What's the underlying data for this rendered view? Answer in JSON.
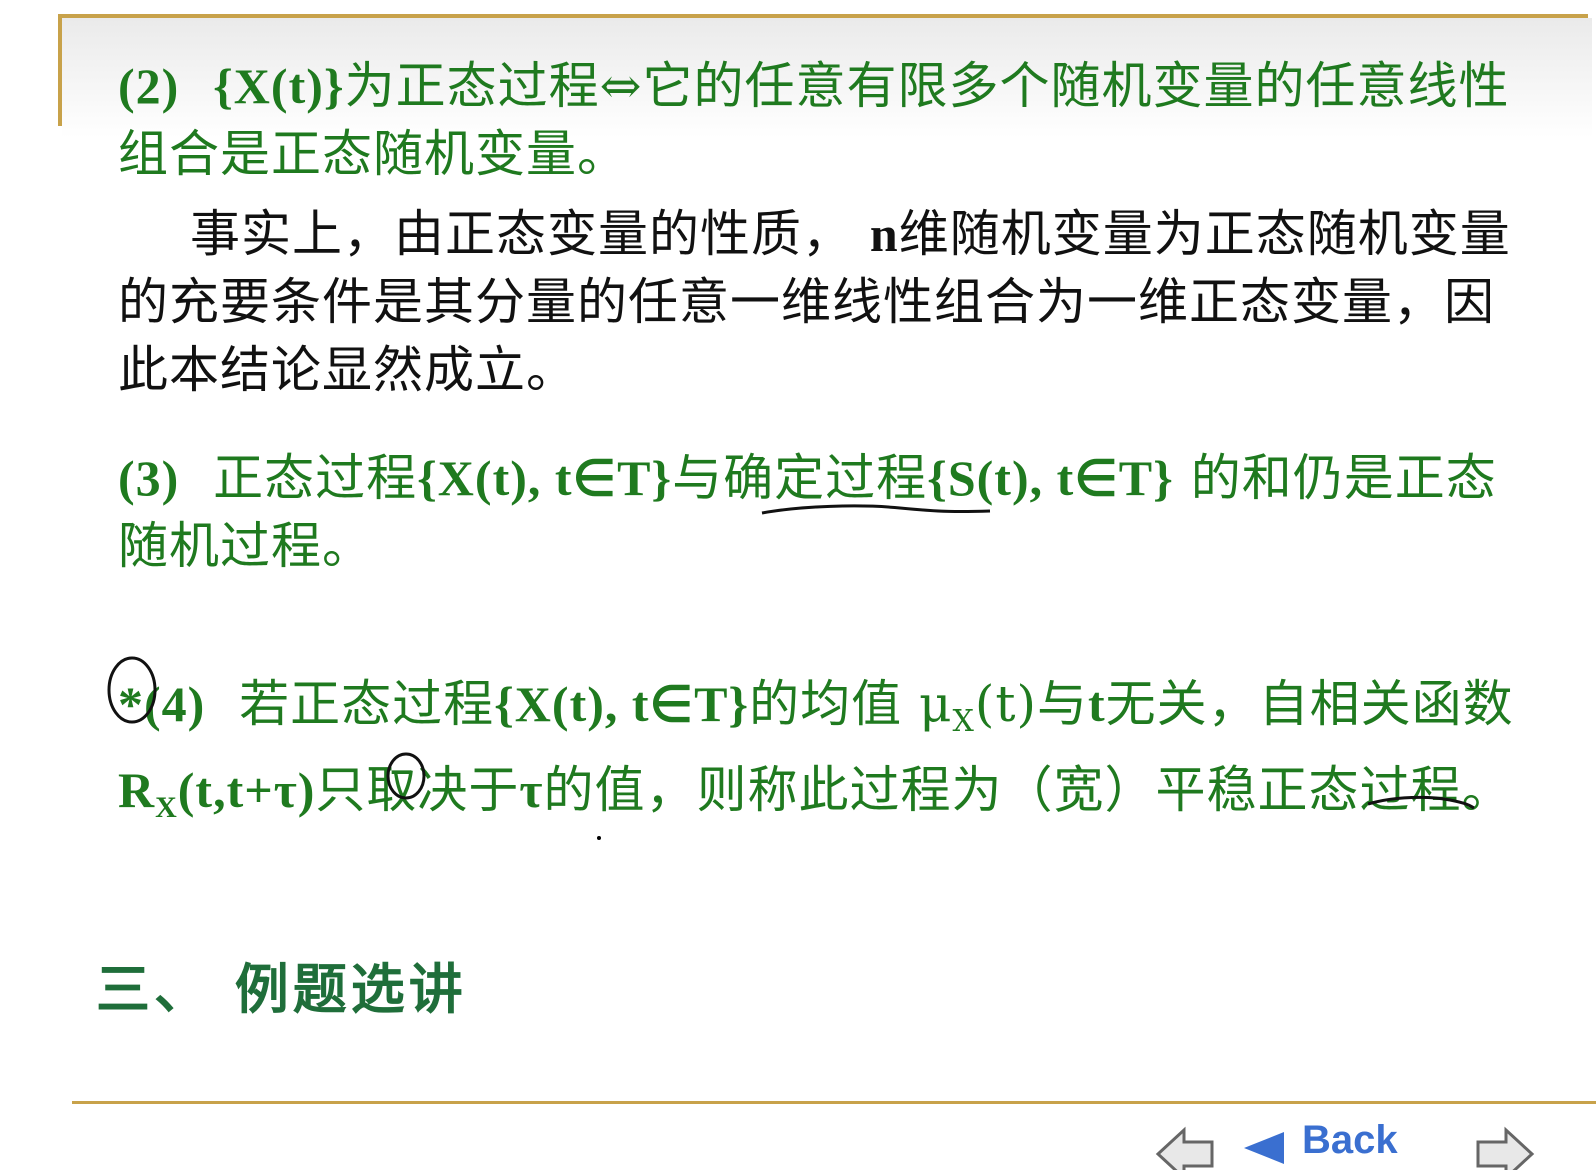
{
  "items": {
    "item2": {
      "num": "(2)",
      "set": "{X(t)}",
      "text1": "为正态过程",
      "iff": "⇔",
      "text2": "它的任意有限多个随机变量的任意线性组合是正态随机变量。"
    },
    "explanation": {
      "t1": "事实上，由正态变量的性质，",
      "n": "n",
      "t2": "维随机变量为正态随机变量的充要条件是其分量的任意一维线性组合为一维正态变量，因此本结论显然成立。"
    },
    "item3": {
      "num": "(3)",
      "t1": "正态过程",
      "set1": "{X(t), t∈T}",
      "t2": "与",
      "det": "确定过程",
      "set2": "{S(t), t∈T}",
      "t3": " 的和仍是正态随机过程。"
    },
    "item4": {
      "star": "*",
      "num": "(4)",
      "t1": "若正态过程",
      "set": "{X(t), t∈T}",
      "t2": "的均值 μ",
      "sub_x": "X",
      "t3": "(t)与",
      "t": "t",
      "t4": "无关，自相关函数",
      "r": "R",
      "sub_x2": "X",
      "args": "(t,t+τ)",
      "t5": "只取决于",
      "tau": "τ",
      "t6": "的值，则称此过程为（宽）",
      "stationary": "平稳",
      "t7": "正态过程。"
    }
  },
  "section_heading": "三、 例题选讲",
  "nav": {
    "back_label": "Back"
  }
}
